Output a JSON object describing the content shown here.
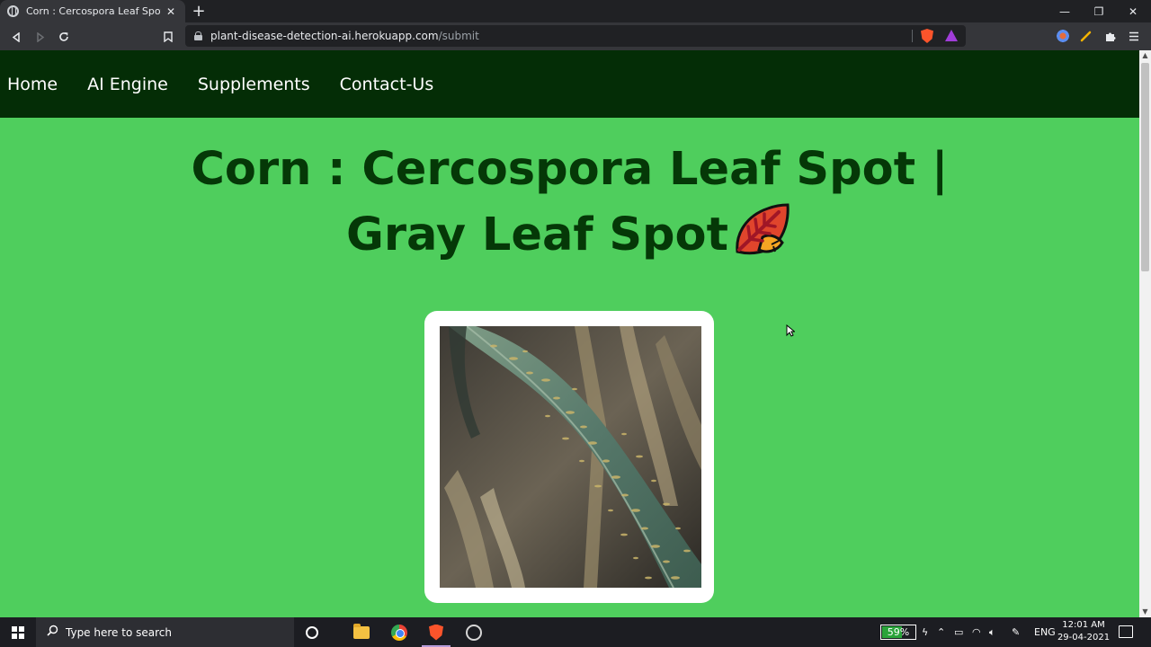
{
  "browser": {
    "tab_title": "Corn : Cercospora Leaf Spot | Gra",
    "tab_close": "✕",
    "new_tab": "+",
    "url_host": "plant-disease-detection-ai.herokuapp.com",
    "url_path": "/submit",
    "window_controls": {
      "minimize": "—",
      "maximize": "❐",
      "close": "✕"
    },
    "nav_icons": [
      "back-arrow-icon",
      "forward-arrow-icon",
      "reload-icon",
      "bookmark-icon"
    ]
  },
  "site": {
    "nav": [
      "Home",
      "AI Engine",
      "Supplements",
      "Contact-Us"
    ],
    "headline_line1": "Corn : Cercospora Leaf Spot |",
    "headline_line2": "Gray Leaf Spot",
    "colors": {
      "navbar": "#042d06",
      "page_bg": "#4fce5d",
      "headline": "#053807"
    }
  },
  "taskbar": {
    "search_placeholder": "Type here to search",
    "battery_percent": "59%",
    "battery_level": 0.59,
    "language": "ENG",
    "time": "12:01 AM",
    "date": "29-04-2021"
  }
}
